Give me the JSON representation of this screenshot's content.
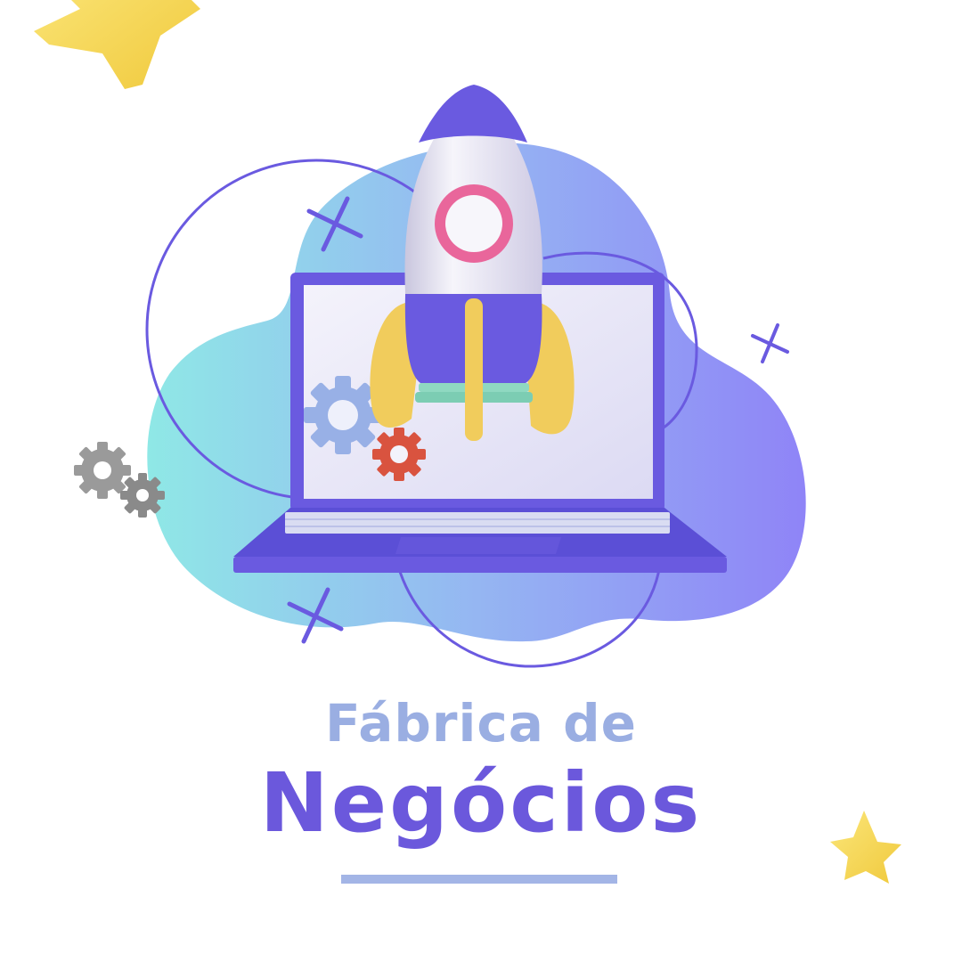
{
  "title": {
    "line1": "Fábrica de",
    "line2": "Negócios"
  },
  "colors": {
    "line1": "#9aaee2",
    "line2": "#6b58dc",
    "underline": "#a3b5e6",
    "purple": "#6a5ae0",
    "blob_start": "#8fe8e6",
    "blob_end": "#8f84f7",
    "star": "#f7d85a",
    "gear_blue": "#98b0e6",
    "gear_red": "#d9533f",
    "gear_gray": "#9a9a9a"
  },
  "icons": [
    "star-icon",
    "gear-icon",
    "rocket-icon",
    "laptop-icon",
    "cross-icon"
  ]
}
